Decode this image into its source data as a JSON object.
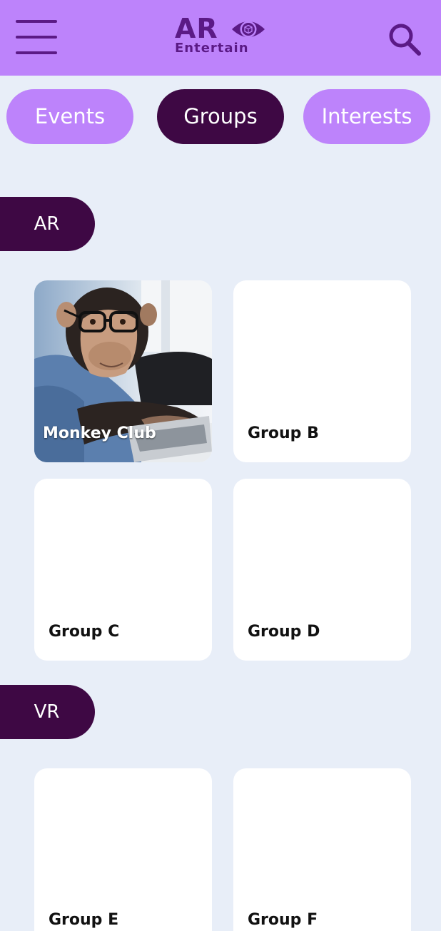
{
  "header": {
    "logo_text_main": "AR",
    "logo_text_sub": "Entertain",
    "brand_color": "#bd83fb",
    "accent_color": "#5b1a86"
  },
  "tabs": [
    {
      "label": "Events",
      "active": false
    },
    {
      "label": "Groups",
      "active": true
    },
    {
      "label": "Interests",
      "active": false
    }
  ],
  "sections": [
    {
      "label": "AR",
      "groups": [
        {
          "title": "Monkey Club",
          "image": "monkey-photo"
        },
        {
          "title": "Group B"
        },
        {
          "title": "Group C"
        },
        {
          "title": "Group D"
        }
      ]
    },
    {
      "label": "VR",
      "groups": [
        {
          "title": "Group E"
        },
        {
          "title": "Group F"
        }
      ]
    }
  ],
  "colors": {
    "background": "#e8eef8",
    "active_tab": "#3e0844",
    "section_label": "#3e0844"
  },
  "icons": {
    "menu": "hamburger-icon",
    "search": "search-icon",
    "logo_eye": "eye-icon"
  }
}
